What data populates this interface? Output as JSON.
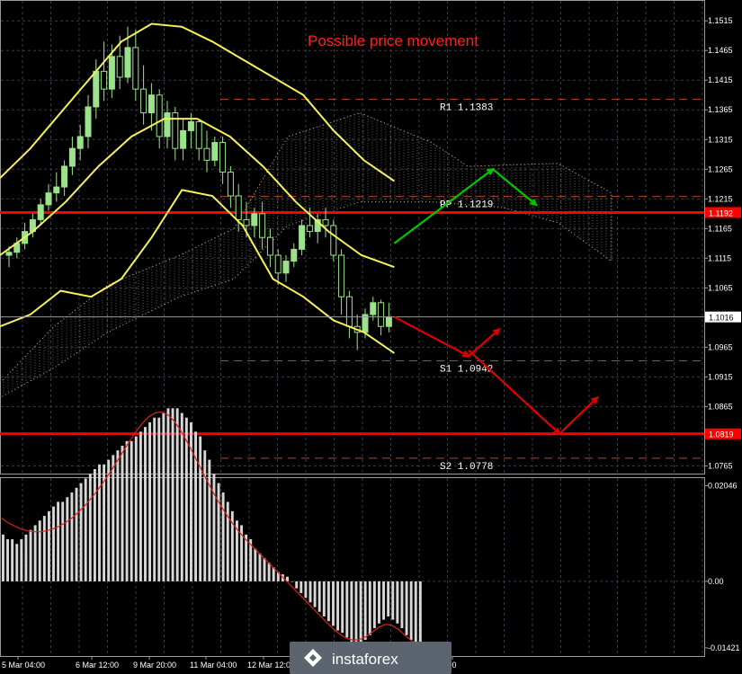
{
  "chart_data": [
    {
      "type": "candlestick",
      "title": "Possible price movement",
      "y_tick_labels": [
        "1.1515",
        "1.1465",
        "1.1415",
        "1.1365",
        "1.1315",
        "1.1265",
        "1.1215",
        "1.1165",
        "1.1115",
        "1.1065",
        "1.1016",
        "1.0965",
        "1.0915",
        "1.0865",
        "1.0819",
        "1.0765"
      ],
      "ylim": [
        1.0755,
        1.1535
      ],
      "grid": true,
      "x_tick_labels": [
        "5 Mar 04:00",
        "6 Mar 12:00",
        "9 Mar 20:00",
        "11 Mar 04:00",
        "12 Mar 12:00",
        "12:00"
      ],
      "current_price": "1.1016",
      "levels": [
        {
          "label": "R1",
          "value": "1.1383",
          "style": "dashed",
          "color": "#b5452f"
        },
        {
          "label": "PP",
          "value": "1.1219",
          "style": "dashed",
          "color": "#b5452f"
        },
        {
          "label": "S1",
          "value": "1.0942",
          "style": "dashed",
          "color": "#b5452f"
        },
        {
          "label": "S2",
          "value": "1.0778",
          "style": "dashed",
          "color": "#b5452f"
        },
        {
          "label": "",
          "value": "1.1192",
          "style": "solid",
          "color": "#ff0000"
        },
        {
          "label": "",
          "value": "1.0819",
          "style": "solid",
          "color": "#ff0000"
        }
      ],
      "candles": [
        [
          1.112,
          1.1135,
          1.11,
          1.1125
        ],
        [
          1.1125,
          1.115,
          1.1115,
          1.114
        ],
        [
          1.114,
          1.1175,
          1.113,
          1.116
        ],
        [
          1.116,
          1.119,
          1.115,
          1.118
        ],
        [
          1.118,
          1.1215,
          1.117,
          1.1205
        ],
        [
          1.1205,
          1.124,
          1.1195,
          1.1225
        ],
        [
          1.1225,
          1.126,
          1.121,
          1.1235
        ],
        [
          1.1235,
          1.128,
          1.122,
          1.127
        ],
        [
          1.127,
          1.132,
          1.1255,
          1.13
        ],
        [
          1.13,
          1.134,
          1.128,
          1.132
        ],
        [
          1.132,
          1.139,
          1.13,
          1.137
        ],
        [
          1.137,
          1.145,
          1.135,
          1.143
        ],
        [
          1.143,
          1.148,
          1.138,
          1.14
        ],
        [
          1.14,
          1.1475,
          1.1385,
          1.1455
        ],
        [
          1.1455,
          1.149,
          1.14,
          1.142
        ],
        [
          1.142,
          1.1505,
          1.141,
          1.147
        ],
        [
          1.147,
          1.15,
          1.138,
          1.14
        ],
        [
          1.14,
          1.144,
          1.134,
          1.136
        ],
        [
          1.136,
          1.141,
          1.133,
          1.139
        ],
        [
          1.139,
          1.14,
          1.13,
          1.132
        ],
        [
          1.132,
          1.138,
          1.13,
          1.136
        ],
        [
          1.136,
          1.137,
          1.128,
          1.13
        ],
        [
          1.13,
          1.135,
          1.128,
          1.133
        ],
        [
          1.133,
          1.136,
          1.13,
          1.1345
        ],
        [
          1.1345,
          1.135,
          1.128,
          1.13
        ],
        [
          1.13,
          1.133,
          1.126,
          1.128
        ],
        [
          1.128,
          1.132,
          1.127,
          1.131
        ],
        [
          1.131,
          1.132,
          1.124,
          1.126
        ],
        [
          1.126,
          1.127,
          1.12,
          1.122
        ],
        [
          1.122,
          1.124,
          1.116,
          1.118
        ],
        [
          1.118,
          1.121,
          1.115,
          1.117
        ],
        [
          1.117,
          1.12,
          1.115,
          1.119
        ],
        [
          1.119,
          1.121,
          1.113,
          1.115
        ],
        [
          1.115,
          1.1165,
          1.11,
          1.112
        ],
        [
          1.112,
          1.113,
          1.107,
          1.109
        ],
        [
          1.109,
          1.112,
          1.1075,
          1.111
        ],
        [
          1.111,
          1.114,
          1.11,
          1.113
        ],
        [
          1.113,
          1.118,
          1.112,
          1.117
        ],
        [
          1.117,
          1.12,
          1.115,
          1.116
        ],
        [
          1.116,
          1.119,
          1.114,
          1.118
        ],
        [
          1.118,
          1.12,
          1.115,
          1.117
        ],
        [
          1.117,
          1.118,
          1.111,
          1.112
        ],
        [
          1.112,
          1.113,
          1.102,
          1.105
        ],
        [
          1.105,
          1.106,
          1.098,
          1.1
        ],
        [
          1.1,
          1.102,
          1.096,
          1.099
        ],
        [
          1.099,
          1.103,
          1.098,
          1.102
        ],
        [
          1.102,
          1.105,
          1.101,
          1.104
        ],
        [
          1.104,
          1.1045,
          1.0985,
          1.1
        ],
        [
          1.1,
          1.104,
          1.099,
          1.1016
        ]
      ],
      "bollinger_upper": [
        1.125,
        1.13,
        1.136,
        1.142,
        1.148,
        1.151,
        1.1505,
        1.148,
        1.145,
        1.142,
        1.139,
        1.133,
        1.128,
        1.1245
      ],
      "bollinger_middle": [
        1.112,
        1.116,
        1.121,
        1.127,
        1.132,
        1.135,
        1.135,
        1.132,
        1.127,
        1.121,
        1.116,
        1.112,
        1.11
      ],
      "bollinger_lower": [
        1.1,
        1.102,
        1.106,
        1.105,
        1.108,
        1.115,
        1.123,
        1.122,
        1.117,
        1.108,
        1.105,
        1.101,
        1.099,
        1.0955
      ],
      "forecast_paths": [
        {
          "color": "#00c800",
          "points": [
            [
              "c48",
              1.114
            ],
            [
              "f1",
              1.1265
            ],
            [
              "f2",
              1.1205
            ]
          ]
        },
        {
          "color": "#e00000",
          "points": [
            [
              "c48",
              1.1016
            ],
            [
              "f1b",
              1.095
            ],
            [
              "f2b",
              1.0995
            ]
          ]
        },
        {
          "color": "#e00000",
          "points": [
            [
              "f1b",
              1.096
            ],
            [
              "f3",
              1.0819
            ],
            [
              "f4",
              1.088
            ]
          ]
        }
      ]
    },
    {
      "type": "histogram",
      "name": "MACD",
      "y_tick_labels": [
        "0.02046",
        "0.00",
        "-0.01421"
      ],
      "ylim": [
        -0.015,
        0.0215
      ],
      "values": [
        0.01,
        0.009,
        0.009,
        0.008,
        0.009,
        0.01,
        0.011,
        0.012,
        0.013,
        0.014,
        0.015,
        0.016,
        0.017,
        0.017,
        0.018,
        0.019,
        0.02,
        0.021,
        0.022,
        0.023,
        0.024,
        0.025,
        0.025,
        0.026,
        0.027,
        0.028,
        0.029,
        0.03,
        0.03,
        0.031,
        0.032,
        0.033,
        0.034,
        0.035,
        0.035,
        0.036,
        0.037,
        0.037,
        0.037,
        0.036,
        0.035,
        0.034,
        0.032,
        0.031,
        0.028,
        0.026,
        0.023,
        0.021,
        0.019,
        0.017,
        0.015,
        0.013,
        0.012,
        0.01,
        0.009,
        0.007,
        0.006,
        0.005,
        0.004,
        0.003,
        0.002,
        0.0015,
        0.001,
        0.0,
        -0.0015,
        -0.0025,
        -0.0035,
        -0.0045,
        -0.0055,
        -0.0065,
        -0.0075,
        -0.0085,
        -0.0095,
        -0.0105,
        -0.011,
        -0.012,
        -0.013,
        -0.014,
        -0.0135,
        -0.0125,
        -0.0115,
        -0.01,
        -0.009,
        -0.0082,
        -0.0075,
        -0.0082,
        -0.009,
        -0.01,
        -0.0115,
        -0.0125,
        -0.0135,
        -0.0138
      ],
      "signal": [
        0.0135,
        0.0125,
        0.0118,
        0.0112,
        0.0108,
        0.0106,
        0.0106,
        0.0108,
        0.0112,
        0.0118,
        0.0126,
        0.0136,
        0.0148,
        0.0162,
        0.0178,
        0.0195,
        0.0214,
        0.0234,
        0.0256,
        0.0278,
        0.03,
        0.032,
        0.0338,
        0.0352,
        0.036,
        0.0362,
        0.0356,
        0.0342,
        0.0322,
        0.0298,
        0.0272,
        0.0245,
        0.0218,
        0.0192,
        0.0168,
        0.0146,
        0.0126,
        0.0108,
        0.0092,
        0.0078,
        0.0064,
        0.005,
        0.0036,
        0.0022,
        0.0008,
        -0.0006,
        -0.002,
        -0.0034,
        -0.0048,
        -0.0062,
        -0.0076,
        -0.009,
        -0.0103,
        -0.0114,
        -0.0122,
        -0.0126,
        -0.0124,
        -0.0118,
        -0.0108,
        -0.0098,
        -0.0092,
        -0.0094,
        -0.0102,
        -0.0114,
        -0.0126,
        -0.0134,
        -0.0138
      ]
    }
  ],
  "watermark": "instaforex"
}
